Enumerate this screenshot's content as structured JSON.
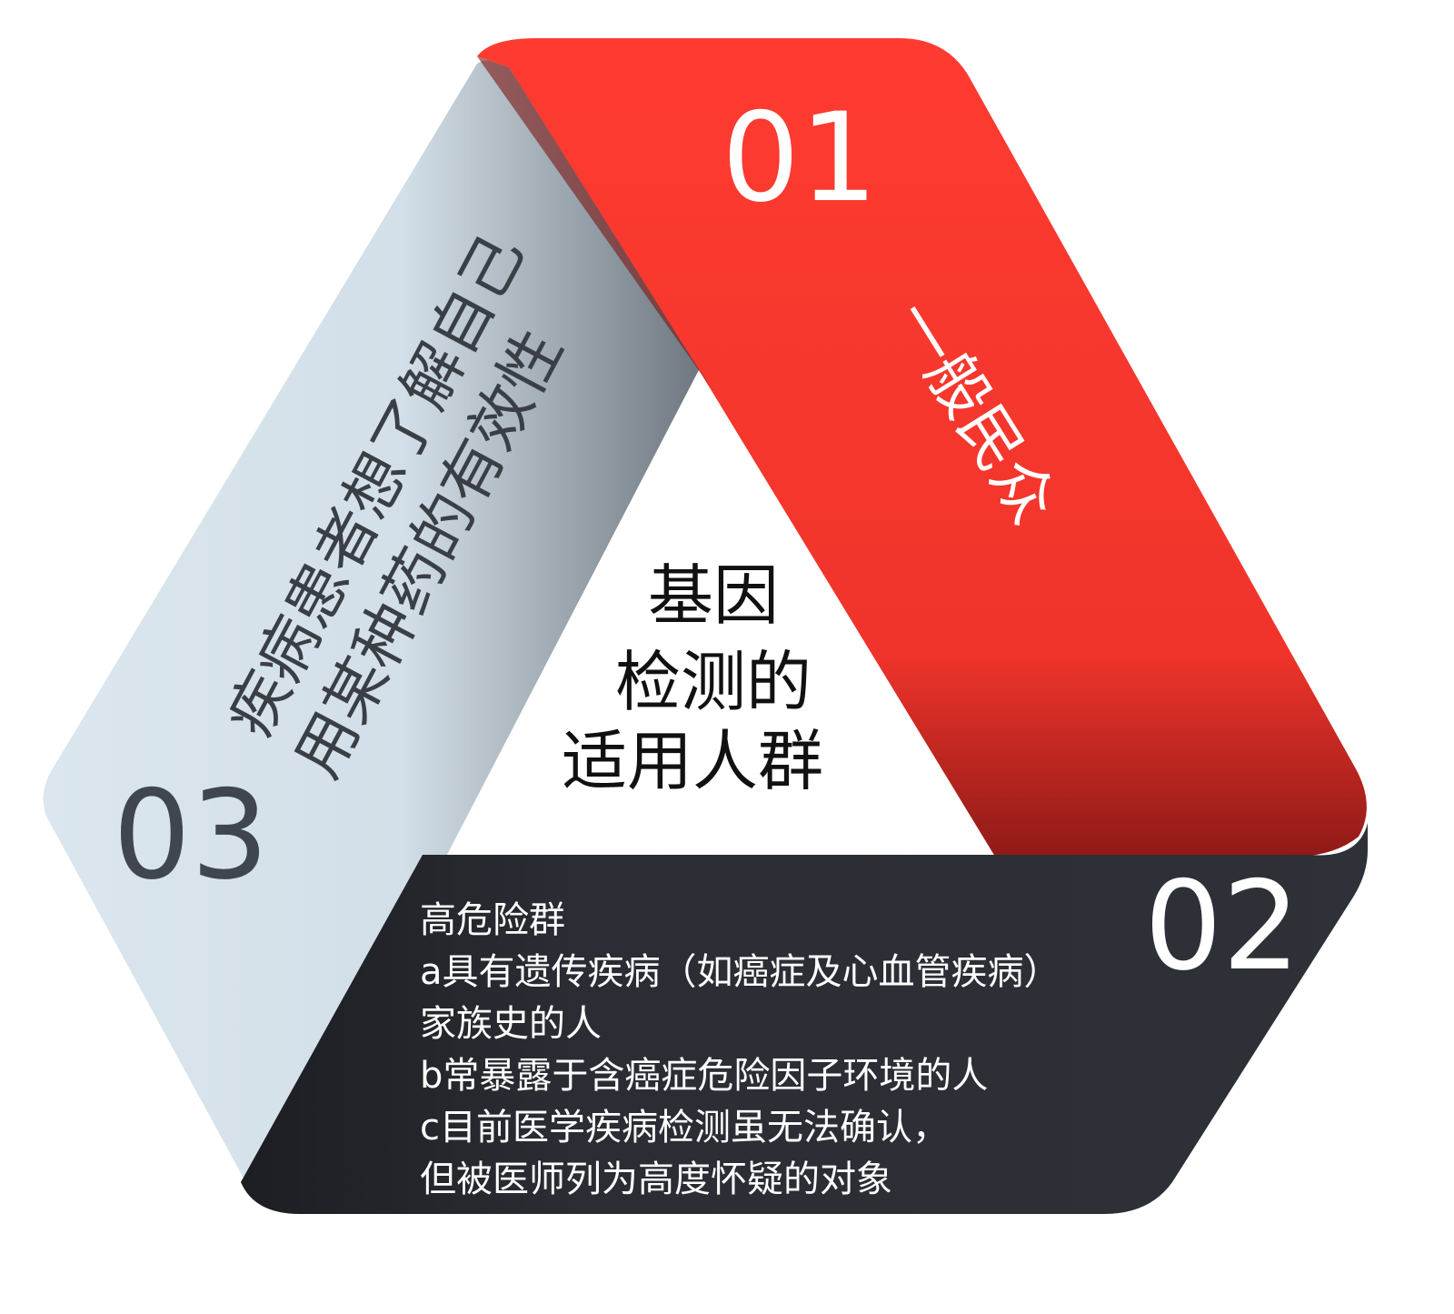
{
  "center": {
    "lines": [
      "基因",
      "检测的",
      "适用人群"
    ]
  },
  "segments": [
    {
      "number": "01",
      "label": "一般民众",
      "color": "#ff3b30"
    },
    {
      "number": "02",
      "title": "高危险群",
      "lines": [
        "a具有遗传疾病（如癌症及心血管疾病）",
        "家族史的人",
        "b常暴露于含癌症危险因子环境的人",
        "c目前医学疾病检测虽无法确认，",
        "但被医师列为高度怀疑的对象"
      ],
      "color": "#2a2d33"
    },
    {
      "number": "03",
      "label_lines": [
        "疾病患者想了解自己",
        "用某种药的有效性"
      ],
      "color": "#dbe7ef"
    }
  ]
}
